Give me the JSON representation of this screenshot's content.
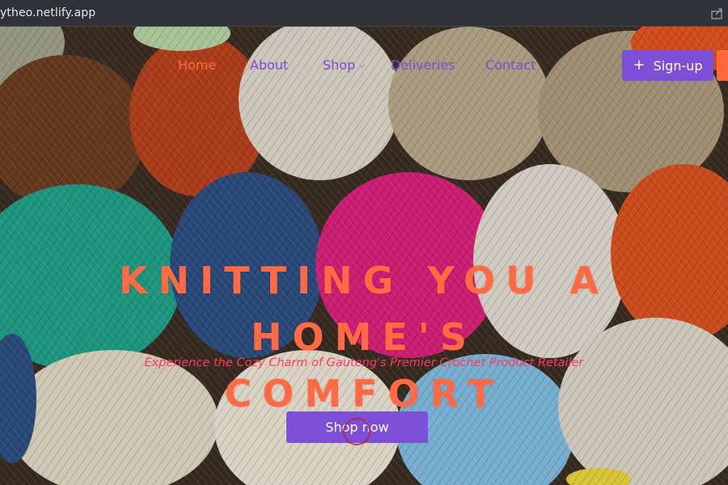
{
  "browser": {
    "url": "ytheo.netlify.app",
    "share_icon": "share-icon"
  },
  "nav": {
    "items": [
      {
        "label": "Home",
        "active": true
      },
      {
        "label": "About",
        "active": false
      },
      {
        "label": "Shop",
        "active": false,
        "icon": "chevron-down-icon"
      },
      {
        "label": "Deliveries",
        "active": false
      },
      {
        "label": "Contact",
        "active": false
      }
    ],
    "signup_label": "Sign-up",
    "signup_icon": "plus-icon"
  },
  "hero": {
    "headline_line1": "KNITTING YOU A HOME'S",
    "headline_line2": "COMFORT",
    "subtitle": "Experience the Cozy Charm of Gauteng's Premier Crochet Product Retailer",
    "cta_label": "Shop now",
    "background": "yarn-balls-photo"
  },
  "colors": {
    "accent_purple": "#7d4fd6",
    "accent_orange": "#ff6a3d",
    "subtitle_pink": "#ff3b5c"
  }
}
